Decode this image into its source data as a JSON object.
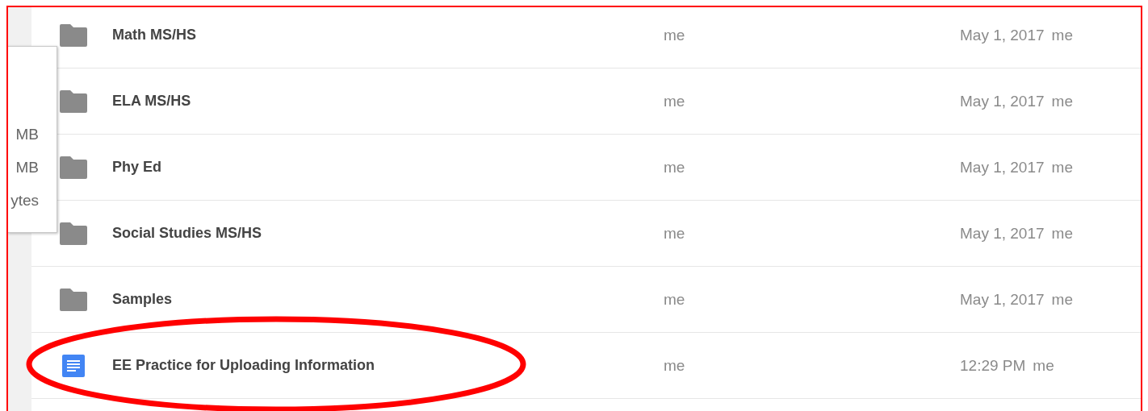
{
  "size_popup": {
    "items": [
      "MB",
      "MB",
      "ytes"
    ]
  },
  "files": [
    {
      "kind": "folder",
      "name": "Math MS/HS",
      "owner": "me",
      "modified": "May 1, 2017",
      "modified_by": "me",
      "circled": false
    },
    {
      "kind": "folder",
      "name": "ELA MS/HS",
      "owner": "me",
      "modified": "May 1, 2017",
      "modified_by": "me",
      "circled": false
    },
    {
      "kind": "folder",
      "name": "Phy Ed",
      "owner": "me",
      "modified": "May 1, 2017",
      "modified_by": "me",
      "circled": false
    },
    {
      "kind": "folder",
      "name": "Social Studies MS/HS",
      "owner": "me",
      "modified": "May 1, 2017",
      "modified_by": "me",
      "circled": false
    },
    {
      "kind": "folder",
      "name": "Samples",
      "owner": "me",
      "modified": "May 1, 2017",
      "modified_by": "me",
      "circled": false
    },
    {
      "kind": "document",
      "name": "EE Practice for Uploading Information",
      "owner": "me",
      "modified": "12:29 PM",
      "modified_by": "me",
      "circled": true
    }
  ]
}
